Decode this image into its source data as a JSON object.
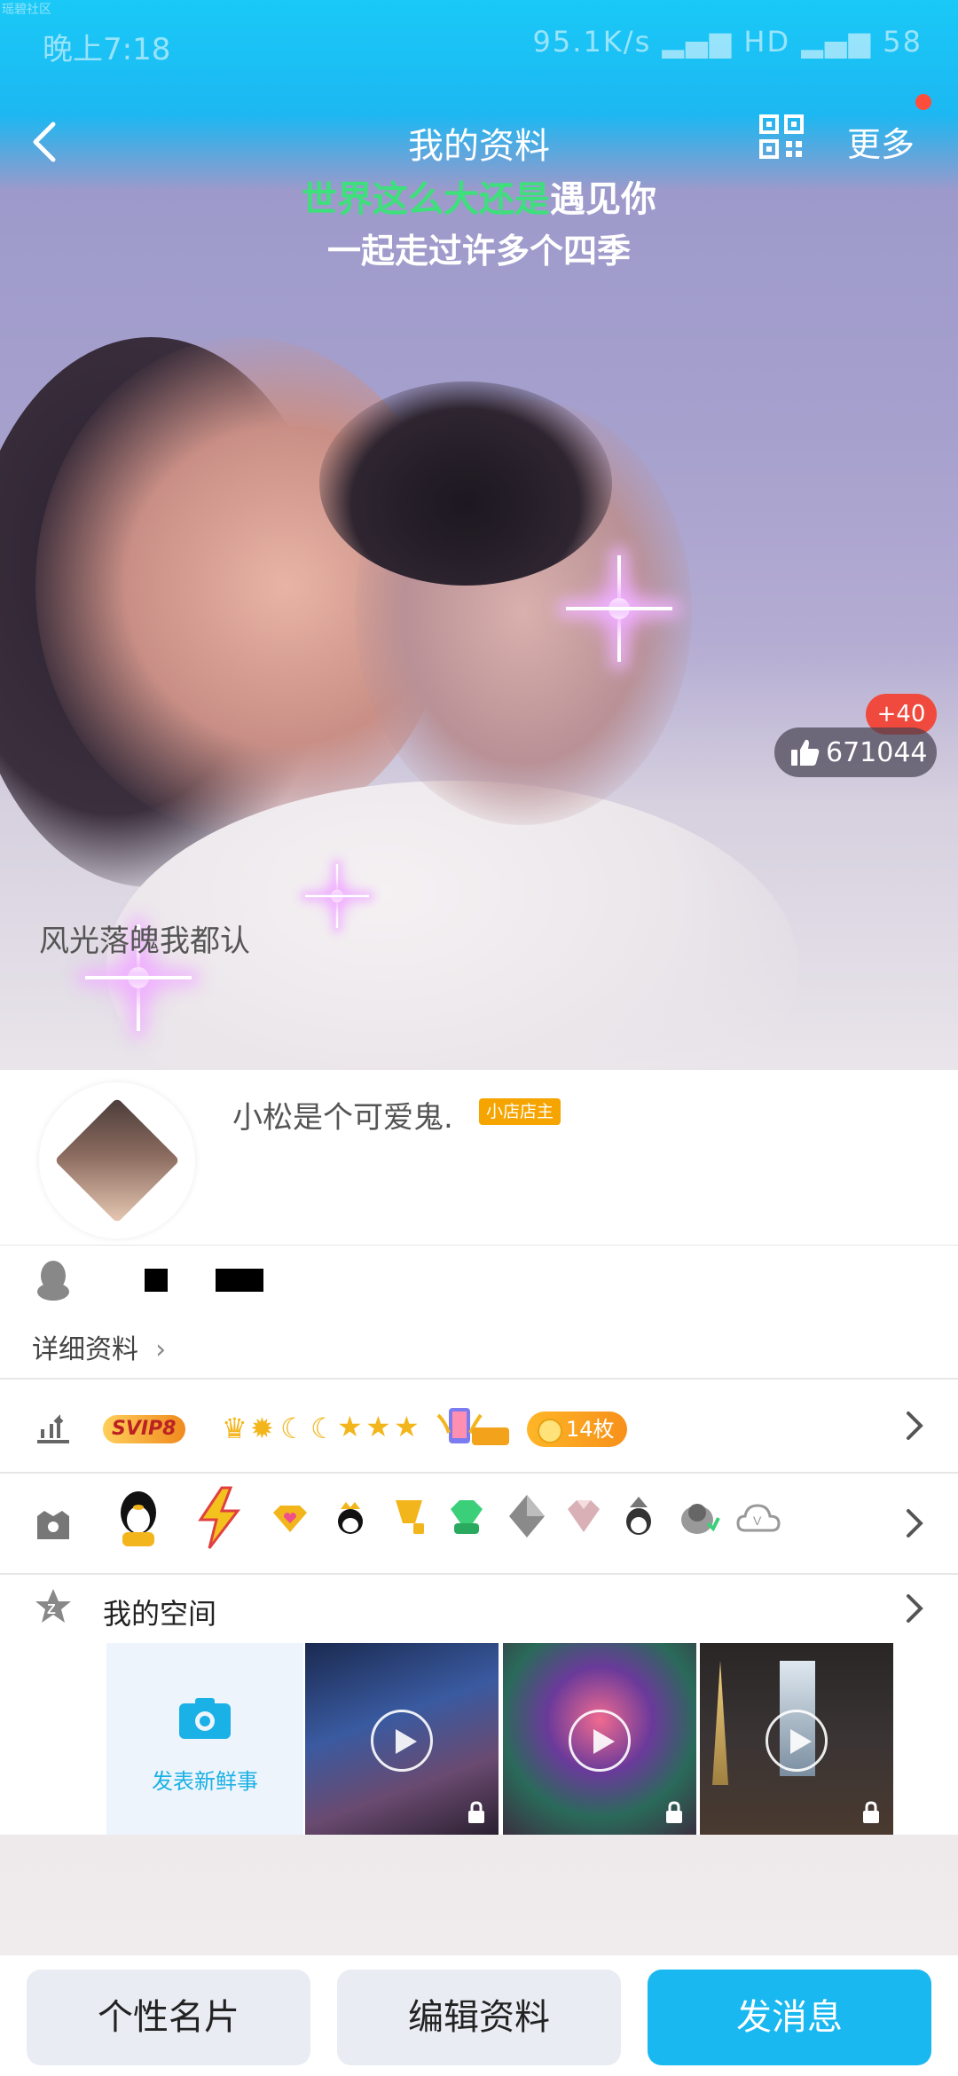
{
  "status_bar": {
    "time": "晚上7:18",
    "net_speed": "95.1K/s",
    "hd": "HD",
    "battery": "58",
    "watermark": "瑶碧社区"
  },
  "nav": {
    "title": "我的资料",
    "more_label": "更多"
  },
  "cover": {
    "lyric_highlight": "世界这么大还是",
    "lyric_rest": "遇见你",
    "lyric_line2": "一起走过许多个四季",
    "like_count": "671044",
    "like_increment": "+40",
    "signature": "风光落魄我都认"
  },
  "profile": {
    "nickname": "小松是个可爱鬼.",
    "shop_badge": "小店店主"
  },
  "info": {
    "detail_link": "详细资料"
  },
  "vip": {
    "svip_label": "SVIP8",
    "coins_label": "14枚"
  },
  "space": {
    "title": "我的空间",
    "post_label": "发表新鲜事"
  },
  "bottom": {
    "card_button": "个性名片",
    "edit_button": "编辑资料",
    "message_button": "发消息"
  },
  "colors": {
    "accent": "#19b8f0",
    "header": "#1ac9f7",
    "badge_red": "#f0493d",
    "coin_orange": "#f7901a"
  }
}
